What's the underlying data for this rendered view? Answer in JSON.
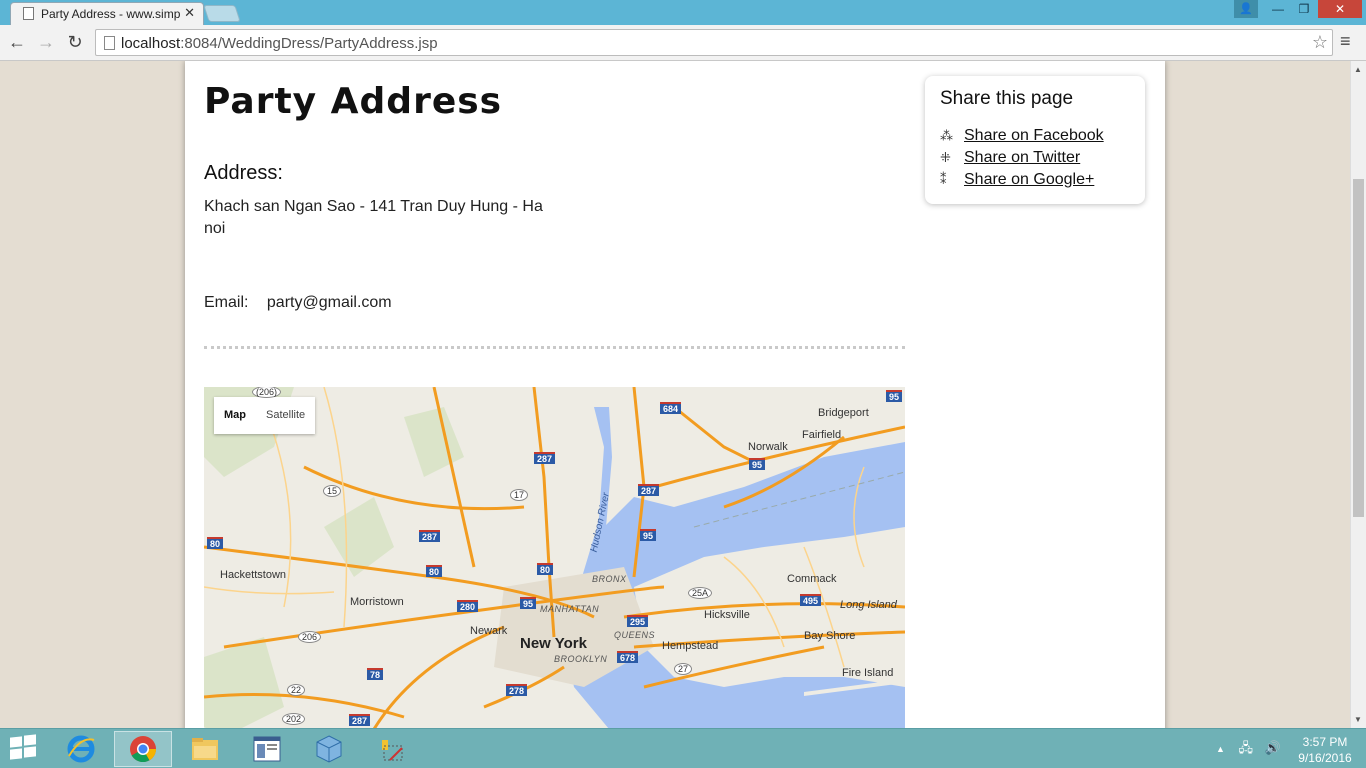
{
  "browser": {
    "tab_title": "Party Address - www.simp",
    "tab_close": "✕",
    "url_host": "localhost",
    "url_rest": ":8084/WeddingDress/PartyAddress.jsp",
    "back_glyph": "←",
    "forward_glyph": "→",
    "reload_glyph": "↻",
    "star_glyph": "☆",
    "menu_glyph": "≡",
    "window": {
      "minimize": "—",
      "maximize": "❐",
      "close": "✕",
      "user": "👤"
    }
  },
  "page": {
    "title": "Party Address",
    "address_heading": "Address:",
    "address_text": "Khach san Ngan Sao - 141 Tran Duy Hung - Ha noi",
    "email_label": "Email:",
    "email_value": "party@gmail.com"
  },
  "map": {
    "type_map": "Map",
    "type_satellite": "Satellite",
    "places": {
      "bridgeport": "Bridgeport",
      "fairfield": "Fairfield",
      "norwalk": "Norwalk",
      "hackettstown": "Hackettstown",
      "morristown": "Morristown",
      "newark": "Newark",
      "new_york": "New York",
      "manhattan": "MANHATTAN",
      "bronx": "BRONX",
      "queens": "QUEENS",
      "brooklyn": "BROOKLYN",
      "hicksville": "Hicksville",
      "hempstead": "Hempstead",
      "commack": "Commack",
      "long_island": "Long Island",
      "bay_shore": "Bay Shore",
      "fire_island": "Fire Island",
      "hudson_river": "Hudson River"
    },
    "routes": {
      "r684": "684",
      "r95a": "95",
      "r287a": "287",
      "r287b": "287",
      "r95b": "95",
      "r95c": "95",
      "r80a": "80",
      "r287c": "287",
      "r80b": "80",
      "r80c": "80",
      "r280": "280",
      "r95d": "95",
      "r295": "295",
      "r495": "495",
      "r678": "678",
      "r78": "78",
      "r278": "278",
      "r287d": "287",
      "s206a": "(206)",
      "s15": "15",
      "s17": "17",
      "s206b": "206",
      "s22": "22",
      "s202": "202",
      "s25a": "25A",
      "s27": "27"
    }
  },
  "share": {
    "title": "Share this page",
    "facebook": "Share on Facebook",
    "twitter": "Share on Twitter",
    "google": "Share on Google+",
    "facebook_icon": "⁂",
    "twitter_icon": "⁜",
    "google_icon": "⁑"
  },
  "taskbar": {
    "time": "3:57 PM",
    "date": "9/16/2016",
    "tray_arrow": "▲",
    "tray_network": "🖧",
    "tray_volume": "🔊"
  }
}
